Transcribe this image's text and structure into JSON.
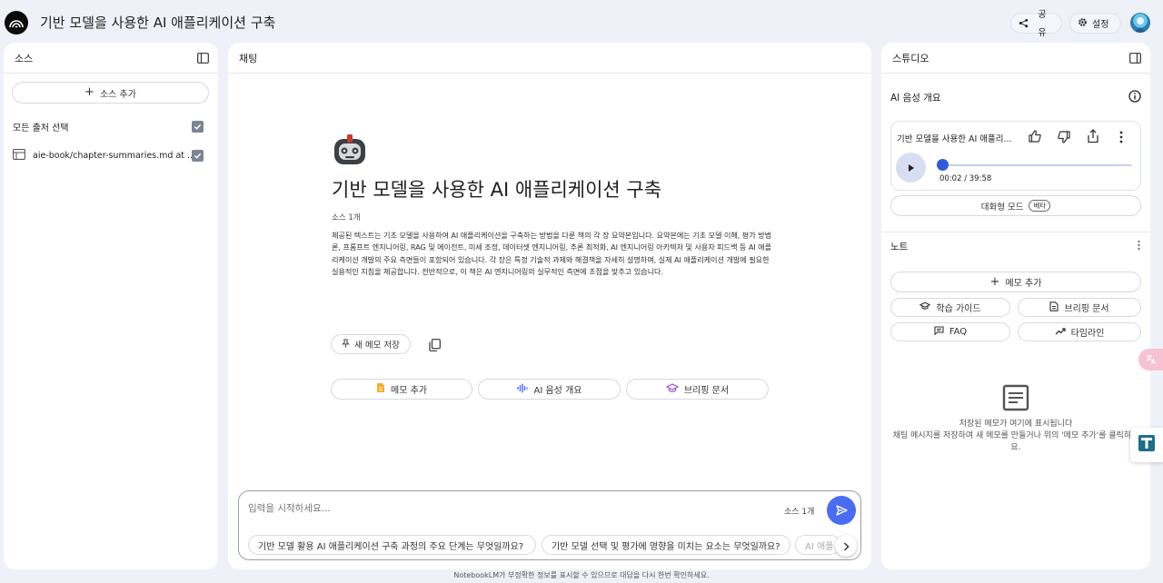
{
  "app": {
    "title": "기반 모델을 사용한 AI 애플리케이션 구축",
    "share_label": "공유",
    "settings_label": "설정"
  },
  "sources": {
    "header": "소스",
    "add_button": "소스 추가",
    "select_all_label": "모든 출처 선택",
    "items": [
      {
        "name": "aie-book/chapter-summaries.md at ..."
      }
    ]
  },
  "chat": {
    "header": "채팅",
    "notebook_title": "기반 모델을 사용한 AI 애플리케이션 구축",
    "source_count": "소스 1개",
    "summary": "제공된 텍스트는 기초 모델을 사용하여 AI 애플리케이션을 구축하는 방법을 다룬 책의 각 장 요약본입니다. 요약본에는 기초 모델 이해, 평가 방법론, 프롬프트 엔지니어링, RAG 및 에이전트, 미세 조정, 데이터셋 엔지니어링, 추론 최적화, AI 엔지니어링 아키텍처 및 사용자 피드백 등 AI 애플리케이션 개발의 주요 측면들이 포함되어 있습니다. 각 장은 특정 기술적 과제와 해결책을 자세히 설명하며, 실제 AI 애플리케이션 개발에 필요한 실용적인 지침을 제공합니다. 전반적으로, 이 책은 AI 엔지니어링의 실무적인 측면에 초점을 맞추고 있습니다.",
    "save_note_button": "새 메모 저장",
    "action_buttons": [
      "메모 추가",
      "AI 음성 개요",
      "브리핑 문서"
    ],
    "input_placeholder": "입력을 시작하세요...",
    "input_source_count": "소스 1개",
    "suggestions": [
      "기반 모델 활용 AI 애플리케이션 구축 과정의 주요 단계는 무엇일까요?",
      "기반 모델 선택 및 평가에 영향을 미치는 요소는 무엇일까요?",
      "AI 애플"
    ]
  },
  "studio": {
    "header": "스튜디오",
    "audio_overview_title": "AI 음성 개요",
    "audio": {
      "title": "기반 모델을 사용한 AI 애플리...",
      "time": "00:02 / 39:58",
      "progress": 0.001
    },
    "interactive_mode_label": "대화형 모드",
    "beta_badge": "베타",
    "notes_header": "노트",
    "add_note_button": "메모 추가",
    "note_buttons": [
      "학습 가이드",
      "브리핑 문서",
      "FAQ",
      "타임라인"
    ],
    "empty_title": "저장된 메모가 여기에 표시됩니다",
    "empty_desc": "채팅 메시지를 저장하여 새 메모를 만들거나 위의 '메모 추가'를 클릭하세요."
  },
  "footer_note": "NotebookLM가 부정확한 정보를 표시할 수 있으므로 대답을 다시 한번 확인하세요.",
  "colors": {
    "accent": "#4a6cf0",
    "background": "#eef2f8",
    "panel": "#ffffff",
    "checkbox": "#7c8591"
  },
  "icons": [
    "notebooklm-logo-icon",
    "share-icon",
    "gear-icon",
    "panel-toggle-icon",
    "plus-icon",
    "checkbox-checked-icon",
    "document-icon",
    "robot-icon",
    "pin-icon",
    "copy-icon",
    "sticky-note-icon",
    "waveform-icon",
    "graduation-cap-icon",
    "send-icon",
    "chevron-right-icon",
    "info-icon",
    "thumbs-up-icon",
    "thumbs-down-icon",
    "share-up-icon",
    "more-vert-icon",
    "play-icon",
    "note-chat-icon",
    "trending-icon",
    "article-icon",
    "translate-icon"
  ]
}
